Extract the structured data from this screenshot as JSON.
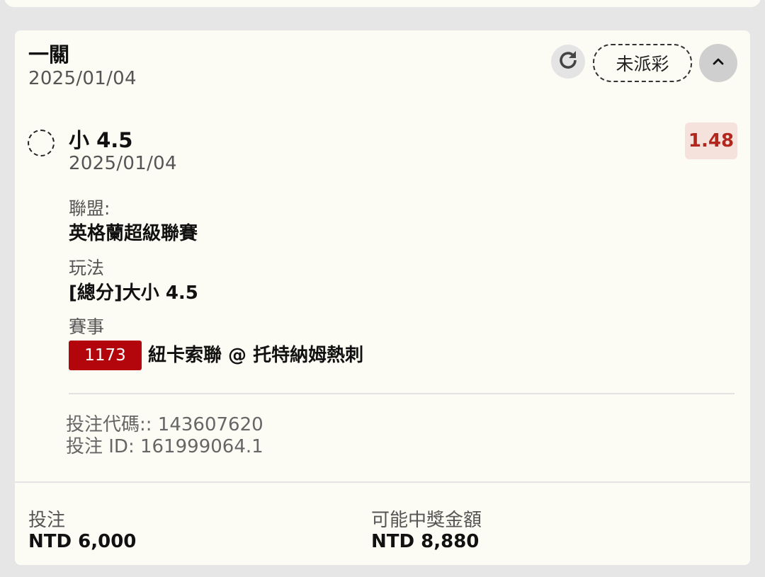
{
  "bet": {
    "type_title": "一關",
    "date": "2025/01/04",
    "status_label": "未派彩"
  },
  "selection": {
    "name": "小 4.5",
    "date": "2025/01/04",
    "odds": "1.48"
  },
  "details": {
    "league_label": "聯盟:",
    "league_value": "英格蘭超級聯賽",
    "market_label": "玩法",
    "market_value": "[總分]大小 4.5",
    "event_label": "賽事",
    "event_code": "1173",
    "event_name": "紐卡索聯 @ 托特納姆熱刺"
  },
  "meta": {
    "bet_code": "投注代碼:: 143607620",
    "bet_id": "投注 ID: 161999064.1"
  },
  "footer": {
    "stake_label": "投注",
    "stake_value": "NTD 6,000",
    "payout_label": "可能中獎金額",
    "payout_value": "NTD 8,880"
  },
  "icons": {
    "refresh": "refresh-icon",
    "collapse": "chevron-up-icon",
    "status": "pending-circle-icon"
  },
  "colors": {
    "card_background": "#fdfcf4",
    "odds_text": "#b3261e",
    "odds_background": "#f5e2dd",
    "event_badge": "#b3060c"
  }
}
